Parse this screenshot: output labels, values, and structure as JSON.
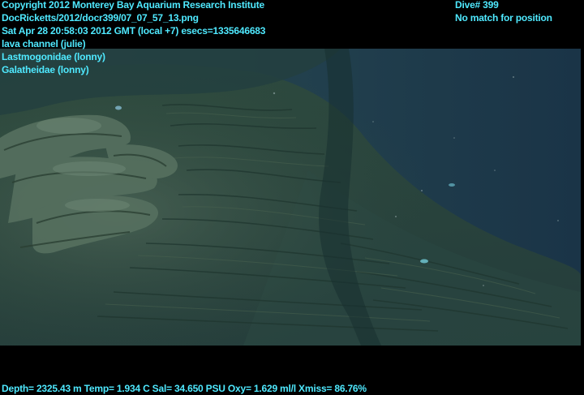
{
  "overlay": {
    "copyright": "Copyright 2012 Monterey Bay Aquarium Research Institute",
    "file_path": "DocRicketts/2012/docr399/07_07_57_13.png",
    "datetime": "Sat Apr 28 20:58:03 2012 GMT (local +7)  esecs=1335646683",
    "annotations": [
      "lava channel (julie)",
      "Lastmogonidae (lonny)",
      "Galatheidae (lonny)"
    ],
    "dive": "Dive# 399",
    "position_status": "No match for position",
    "sensor_readout": "Depth= 2325.43 m  Temp= 1.934 C  Sal= 34.650 PSU  Oxy= 1.629 ml/l  Xmiss= 86.76%"
  },
  "colors": {
    "overlay_text": "#4fe9ff",
    "background": "#000000",
    "water": "#1f3f4d"
  }
}
